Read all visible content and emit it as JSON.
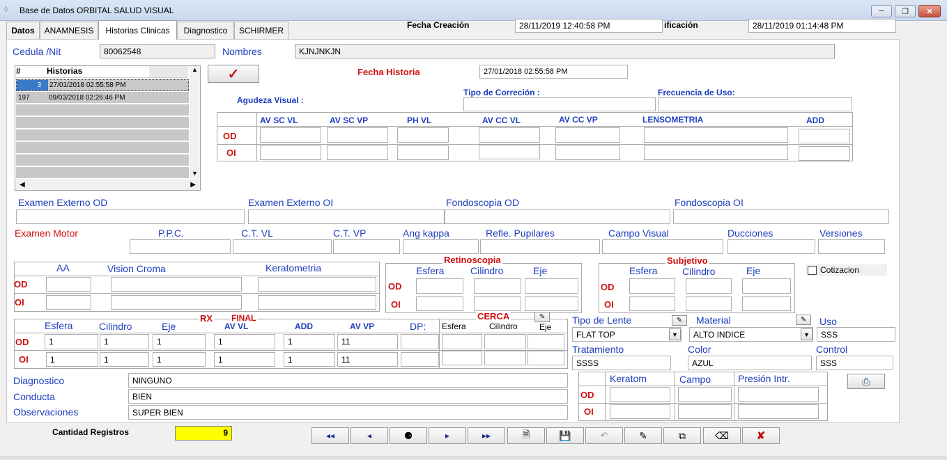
{
  "window": {
    "title": "Base de Datos ORBITAL SALUD VISUAL",
    "minimize": "─",
    "maximize": "❐",
    "close": "✕"
  },
  "tabs": [
    "Datos",
    "ANAMNESIS",
    "Historias Clinicas",
    "Diagnostico",
    "SCHIRMER"
  ],
  "header": {
    "fecha_creacion_label": "Fecha Creación",
    "fecha_creacion_value": "28/11/2019 12:40:58 PM",
    "modificacion_label": "ificación",
    "modificacion_value": "28/11/2019 01:14:48 PM"
  },
  "patient": {
    "cedula_label": "Cedula /Nit",
    "cedula_value": "80062548",
    "nombres_label": "Nombres",
    "nombres_value": "KJNJNKJN"
  },
  "history_grid": {
    "col_num": "#",
    "col_historias": "Historias",
    "rows": [
      {
        "num": "3",
        "date": "27/01/2018 02:55:58 PM"
      },
      {
        "num": "197",
        "date": "09/03/2018 02:26:46 PM"
      }
    ]
  },
  "fecha_historia": {
    "label": "Fecha Historia",
    "value": "27/01/2018 02:55:58 PM"
  },
  "agudeza": {
    "label": "Agudeza Visual :",
    "tipo_correccion_label": "Tipo de Correción :",
    "frecuencia_label": "Frecuencia de Uso:",
    "columns": [
      "AV SC VL",
      "AV SC VP",
      "PH VL",
      "AV CC VL",
      "AV CC VP",
      "LENSOMETRIA",
      "ADD"
    ],
    "rows": [
      "OD",
      "OI"
    ]
  },
  "examenes": {
    "externo_od": "Examen Externo OD",
    "externo_oi": "Examen Externo OI",
    "fondoscopia_od": "Fondoscopia OD",
    "fondoscopia_oi": "Fondoscopia OI"
  },
  "motor": {
    "label": "Examen Motor",
    "ppc": "P.P.C.",
    "ct_vl": "C.T. VL",
    "ct_vp": "C.T. VP",
    "ang_kappa": "Ang kappa",
    "refle": "Refle. Pupilares",
    "campo": "Campo Visual",
    "ducciones": "Ducciones",
    "versiones": "Versiones"
  },
  "aa_group": {
    "aa": "AA",
    "vision_croma": "Vision Croma",
    "keratometria": "Keratometria",
    "od": "OD",
    "oi": "OI"
  },
  "retinoscopia": {
    "title": "Retinoscopia",
    "esfera": "Esfera",
    "cilindro": "Cilindro",
    "eje": "Eje",
    "od": "OD",
    "oi": "OI"
  },
  "subjetivo": {
    "title": "Subjetivo",
    "esfera": "Esfera",
    "cilindro": "Cilindro",
    "eje": "Eje",
    "od": "OD",
    "oi": "OI"
  },
  "cotizacion_label": "Cotizacion",
  "rx": {
    "rx_label": "RX",
    "final_label": "FINAL",
    "esfera": "Esfera",
    "cilindro": "Cilindro",
    "eje": "Eje",
    "av_vl": "AV VL",
    "add": "ADD",
    "av_vp": "AV VP",
    "dp": "DP:",
    "od": "OD",
    "oi": "OI",
    "od_values": {
      "esfera": "1",
      "cilindro": "1",
      "eje": "1",
      "av_vl": "1",
      "add": "1",
      "av_vp": "11"
    },
    "oi_values": {
      "esfera": "1",
      "cilindro": "1",
      "eje": "1",
      "av_vl": "1",
      "add": "1",
      "av_vp": "11"
    }
  },
  "cerca": {
    "title": "CERCA",
    "esfera": "Esfera",
    "cilindro": "Cilindro",
    "eje": "Eje"
  },
  "lente": {
    "tipo_label": "Tipo de Lente",
    "tipo_value": "FLAT TOP",
    "material_label": "Material",
    "material_value": "ALTO INDICE",
    "uso_label": "Uso",
    "uso_value": "SSS",
    "tratamiento_label": "Tratamiento",
    "tratamiento_value": "SSSS",
    "color_label": "Color",
    "color_value": "AZUL",
    "control_label": "Control",
    "control_value": "SSS"
  },
  "notes": {
    "diagnostico_label": "Diagnostico",
    "diagnostico_value": "NINGUNO",
    "conducta_label": "Conducta",
    "conducta_value": "BIEN",
    "observaciones_label": "Observaciones",
    "observaciones_value": "SUPER BIEN"
  },
  "keratom_group": {
    "keratom": "Keratom",
    "campo": "Campo",
    "presion": "Presión Intr.",
    "od": "OD",
    "oi": "OI"
  },
  "footer": {
    "cantidad_label": "Cantidad Registros",
    "cantidad_value": "9"
  },
  "nav": {
    "first": "◂◂",
    "prev": "◂",
    "find": "⚈",
    "next": "▸",
    "last": "▸▸"
  },
  "colors": {
    "label_blue": "#1f3fbf",
    "label_red": "#d01010",
    "count_yellow": "#ffff00",
    "grid_selected": "#3b79c9"
  }
}
